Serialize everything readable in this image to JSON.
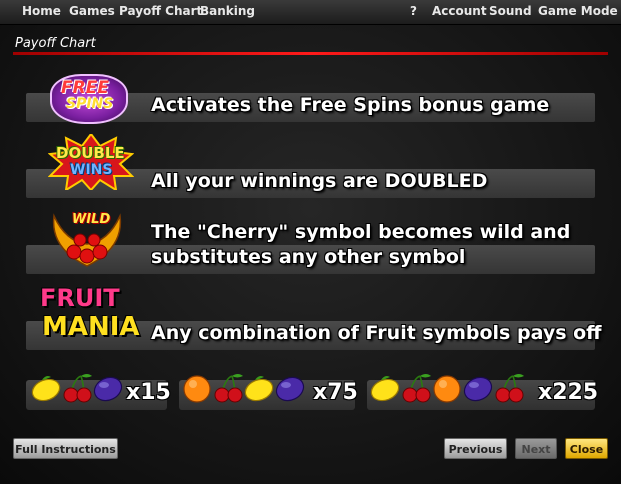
{
  "menu": {
    "left": [
      "Home",
      "Games",
      "Payoff Chart",
      "Banking"
    ],
    "right": [
      "?",
      "Account",
      "Sound",
      "Game Mode"
    ]
  },
  "panel": {
    "title": "Payoff Chart"
  },
  "rows": [
    {
      "logo": "free-spins-logo",
      "logo_text": [
        "FREE",
        "SPINS"
      ],
      "line1": "Activates the Free Spins bonus game",
      "line2": ""
    },
    {
      "logo": "double-wins-logo",
      "logo_text": [
        "DOUBLE",
        "WINS"
      ],
      "line1": "All your winnings are DOUBLED",
      "line2": ""
    },
    {
      "logo": "wild-logo",
      "logo_text": [
        "WILD"
      ],
      "line1": "The \"Cherry\" symbol becomes wild and",
      "line2": "substitutes any other symbol"
    },
    {
      "logo": "fruit-mania-logo",
      "logo_text": [
        "FRUIT",
        "MANIA"
      ],
      "line1": "Any combination of Fruit symbols pays off",
      "line2": ""
    }
  ],
  "payouts": [
    {
      "symbols": [
        "lemon",
        "cherry",
        "plum"
      ],
      "multiplier": "x15"
    },
    {
      "symbols": [
        "orange",
        "cherry",
        "lemon",
        "plum"
      ],
      "multiplier": "x75"
    },
    {
      "symbols": [
        "lemon",
        "cherry",
        "orange",
        "plum",
        "cherry"
      ],
      "multiplier": "x225"
    }
  ],
  "buttons": {
    "full_instructions": "Full Instructions",
    "previous": "Previous",
    "next": "Next",
    "close": "Close"
  },
  "colors": {
    "accent_red": "#ff1a1a",
    "close_yellow": "#e0a800"
  }
}
